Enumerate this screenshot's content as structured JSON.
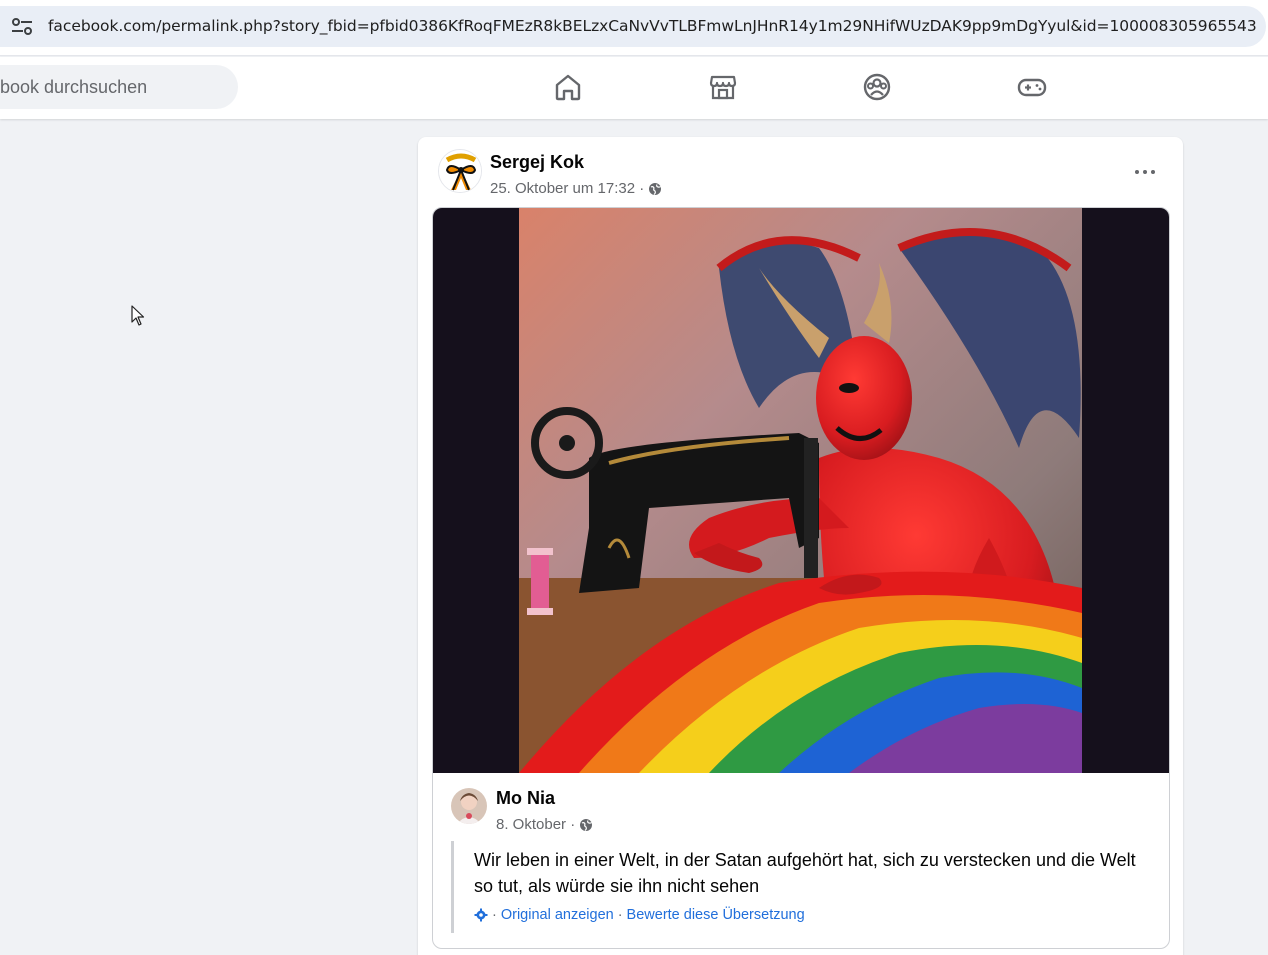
{
  "browser": {
    "url": "facebook.com/permalink.php?story_fbid=pfbid0386KfRoqFMEzR8kBELzxCaNvVvTLBFmwLnJHnR14y1m29NHifWUzDAK9pp9mDgYyul&id=100008305965543"
  },
  "nav": {
    "search_placeholder": "book durchsuchen",
    "icons": [
      "home-icon",
      "marketplace-icon",
      "groups-icon",
      "gaming-icon"
    ]
  },
  "post": {
    "author": "Sergej Kok",
    "timestamp": "25. Oktober um 17:32 ·",
    "privacy_icon": "globe-icon",
    "shared": {
      "author": "Mo Nia",
      "timestamp": "8. Oktober ·",
      "text": "Wir leben in einer Welt, in der Satan aufgehört hat, sich zu verstecken und die Welt so tut, als würde sie ihn nicht sehen",
      "translation": {
        "separator": "·",
        "show_original": "Original anzeigen",
        "rate": "Bewerte diese Übersetzung"
      }
    }
  },
  "colors": {
    "link": "#216fdb",
    "secondary_text": "#65676b",
    "page_bg": "#f0f2f5"
  }
}
